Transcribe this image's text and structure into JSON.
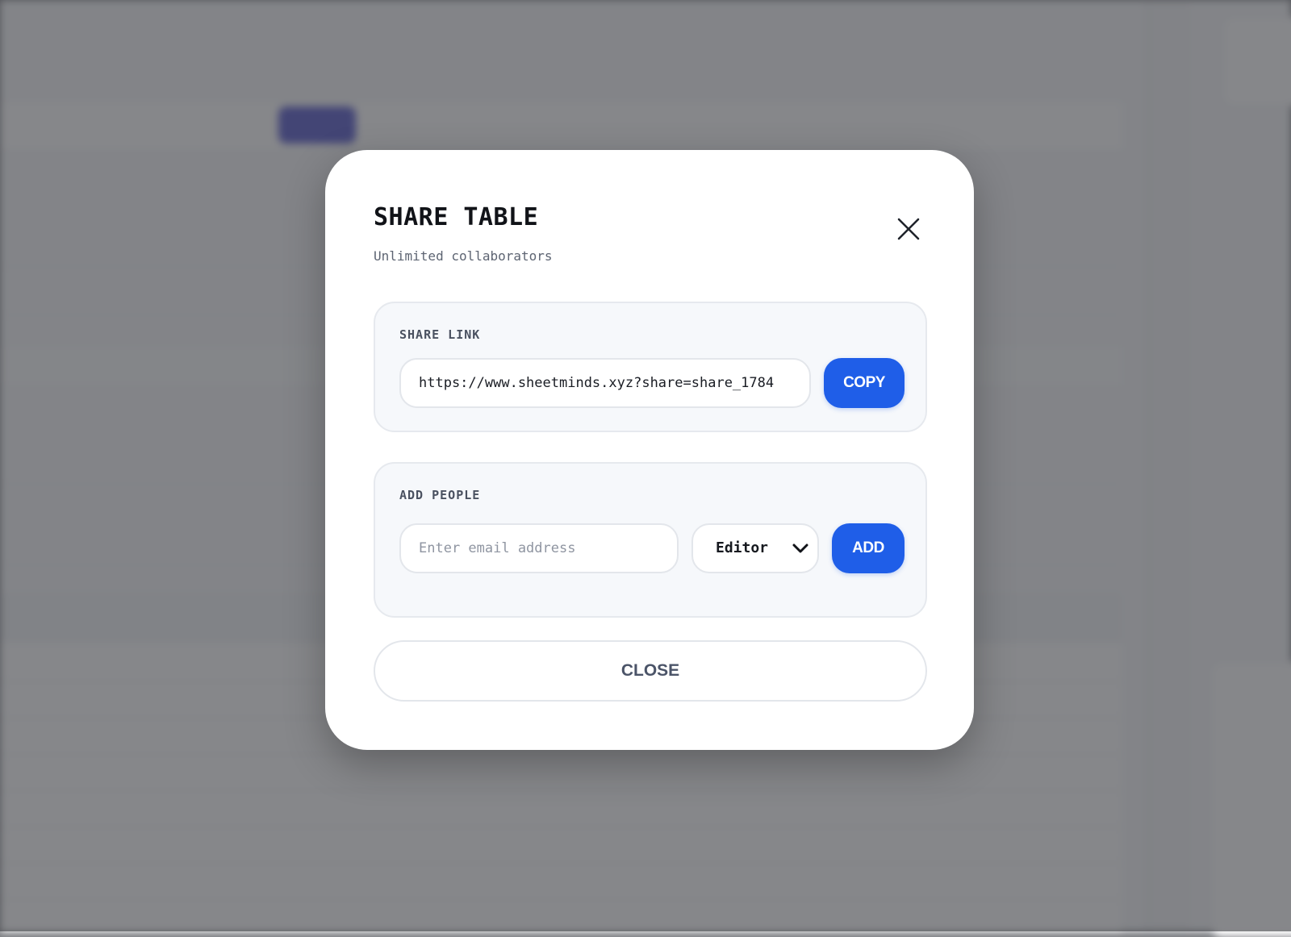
{
  "modal": {
    "title": "SHARE TABLE",
    "subtitle": "Unlimited collaborators",
    "close_icon": "close-icon",
    "share_link": {
      "label": "SHARE LINK",
      "url": "https://www.sheetminds.xyz?share=share_1784",
      "copy_label": "COPY"
    },
    "add_people": {
      "label": "ADD PEOPLE",
      "email_placeholder": "Enter email address",
      "role_selected": "Editor",
      "add_label": "ADD"
    },
    "close_label": "CLOSE"
  },
  "colors": {
    "primary": "#1f5ee8",
    "overlay": "#3c3e42",
    "section_bg": "#f6f8fb"
  }
}
